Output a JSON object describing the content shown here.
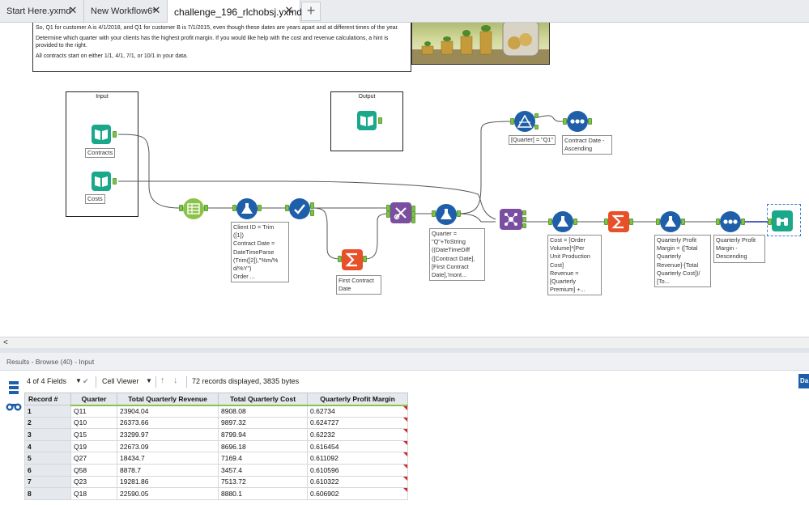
{
  "tabs": [
    {
      "label": "Start Here.yxmd",
      "close": "✕"
    },
    {
      "label": "New Workflow6*",
      "close": "✕"
    },
    {
      "label": "challenge_196_rlchobsj.yxmd",
      "close": "✕"
    }
  ],
  "add_tab": "+",
  "comment": {
    "line1": "So, Q1 for customer A is 4/1/2018, and Q1 for customer B is 7/1/2015, even though these dates are years apart and at different times of the year.",
    "line2": "Determine which quarter with your clients has the highest profit margin.  If you would like help with the cost and revenue calculations, a hint is provided to the right.",
    "line3": "All contracts start on either 1/1, 4/1, 7/1, or 10/1 in your data."
  },
  "containers": {
    "input_title": "Input",
    "output_title": "Output"
  },
  "labels": {
    "contracts": "Contracts",
    "costs": "Costs",
    "formula1": "Client ID = Trim\n([1])\nContract Date =\nDateTimeParse\n(Trim([2]),\"%m/%\nd/%Y\")\nOrder ...",
    "first_contract": "First Contract\nDate",
    "formula2": "Quarter =\n\"Q\"+ToString\n((DateTimeDiff\n([Contract Date],\n[First Contract\nDate],'mont...",
    "filter": "[Quarter] = \"Q1\"",
    "sort1": "Contract Date -\nAscending",
    "formula3": "Cost = [Order\nVolume]*[Per\nUnit Production\nCost]\nRevenue =\n[Quarterly\nPremium] +...",
    "formula4": "Quarterly Profit\nMargin = ([Total\nQuarterly\nRevenue]-[Total\nQuarterly Cost])/\n[To...",
    "sort2": "Quarterly Profit\nMargin -\nDescending"
  },
  "scroll_arrow": "<",
  "results": {
    "title": "Results - Browse (40) - Input",
    "fields": "4 of 4 Fields",
    "cell_viewer": "Cell Viewer",
    "records_info": "72 records displayed, 3835 bytes",
    "corner": "Da",
    "columns": [
      "Record #",
      "Quarter",
      "Total Quarterly Revenue",
      "Total Quarterly Cost",
      "Quarterly Profit Margin"
    ],
    "rows": [
      [
        "1",
        "Q11",
        "23904.04",
        "8908.08",
        "0.62734"
      ],
      [
        "2",
        "Q10",
        "26373.66",
        "9897.32",
        "0.624727"
      ],
      [
        "3",
        "Q15",
        "23299.97",
        "8799.94",
        "0.62232"
      ],
      [
        "4",
        "Q19",
        "22673.09",
        "8696.18",
        "0.616454"
      ],
      [
        "5",
        "Q27",
        "18434.7",
        "7169.4",
        "0.611092"
      ],
      [
        "6",
        "Q58",
        "8878.7",
        "3457.4",
        "0.610596"
      ],
      [
        "7",
        "Q23",
        "19281.86",
        "7513.72",
        "0.610322"
      ],
      [
        "8",
        "Q18",
        "22590.05",
        "8880.1",
        "0.606902"
      ]
    ]
  },
  "colors": {
    "input_tool": "#1aa88a",
    "select_tool": "#8bc34a",
    "formula_tool": "#1f5fa9",
    "summarize_tool": "#e8502a",
    "join_tool": "#7b4fa0",
    "sort_tool": "#1f5fa9",
    "browse_tool": "#1aa88a",
    "anchor": "#7dc24a"
  }
}
